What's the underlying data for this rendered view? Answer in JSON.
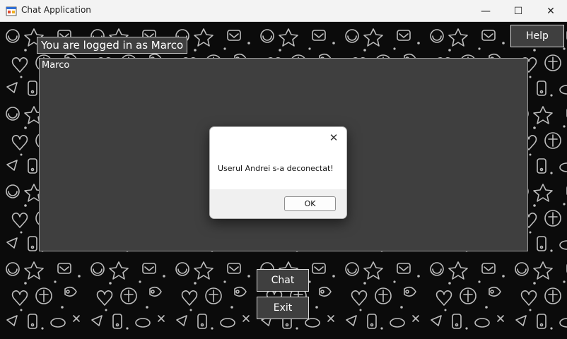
{
  "window": {
    "title": "Chat Application",
    "minimize": "—",
    "maximize": "☐",
    "close": "✕"
  },
  "header": {
    "logged_in_text": "You are logged in as Marco",
    "help_label": "Help"
  },
  "chat": {
    "users": [
      "Marco"
    ]
  },
  "buttons": {
    "chat_label": "Chat",
    "exit_label": "Exit"
  },
  "dialog": {
    "message": "Userul Andrei s-a deconectat!",
    "ok_label": "OK",
    "close": "✕"
  },
  "colors": {
    "background": "#0b0b0b",
    "panel": "#3f3f3f",
    "doodle": "#bfbfbf"
  }
}
